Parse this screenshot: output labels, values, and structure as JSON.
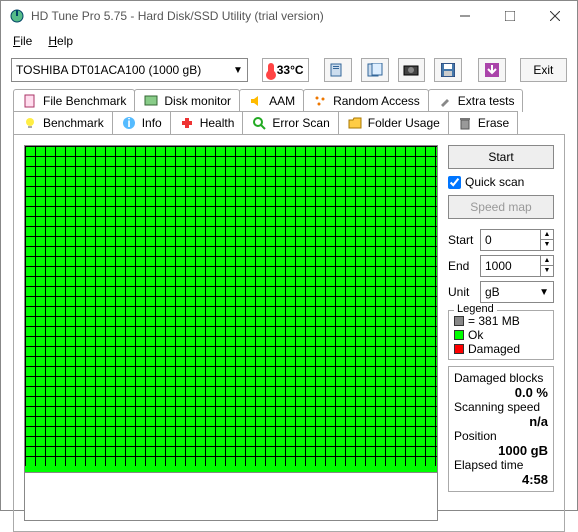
{
  "window": {
    "title": "HD Tune Pro 5.75 - Hard Disk/SSD Utility (trial version)"
  },
  "menu": {
    "file": "File",
    "help": "Help"
  },
  "toolbar": {
    "drive": "TOSHIBA DT01ACA100 (1000 gB)",
    "temp": "33°C",
    "exit": "Exit"
  },
  "tabs": {
    "row1": [
      "File Benchmark",
      "Disk monitor",
      "AAM",
      "Random Access",
      "Extra tests"
    ],
    "row2": [
      "Benchmark",
      "Info",
      "Health",
      "Error Scan",
      "Folder Usage",
      "Erase"
    ]
  },
  "scan": {
    "start_btn": "Start",
    "quickscan": "Quick scan",
    "speedmap": "Speed map",
    "start_label": "Start",
    "start_val": "0",
    "end_label": "End",
    "end_val": "1000",
    "unit_label": "Unit",
    "unit_val": "gB",
    "legend_title": "Legend",
    "legend_block": "= 381 MB",
    "legend_ok": "Ok",
    "legend_damaged": "Damaged",
    "damaged_label": "Damaged blocks",
    "damaged_val": "0.0 %",
    "speed_label": "Scanning speed",
    "speed_val": "n/a",
    "pos_label": "Position",
    "pos_val": "1000 gB",
    "time_label": "Elapsed time",
    "time_val": "4:58"
  }
}
